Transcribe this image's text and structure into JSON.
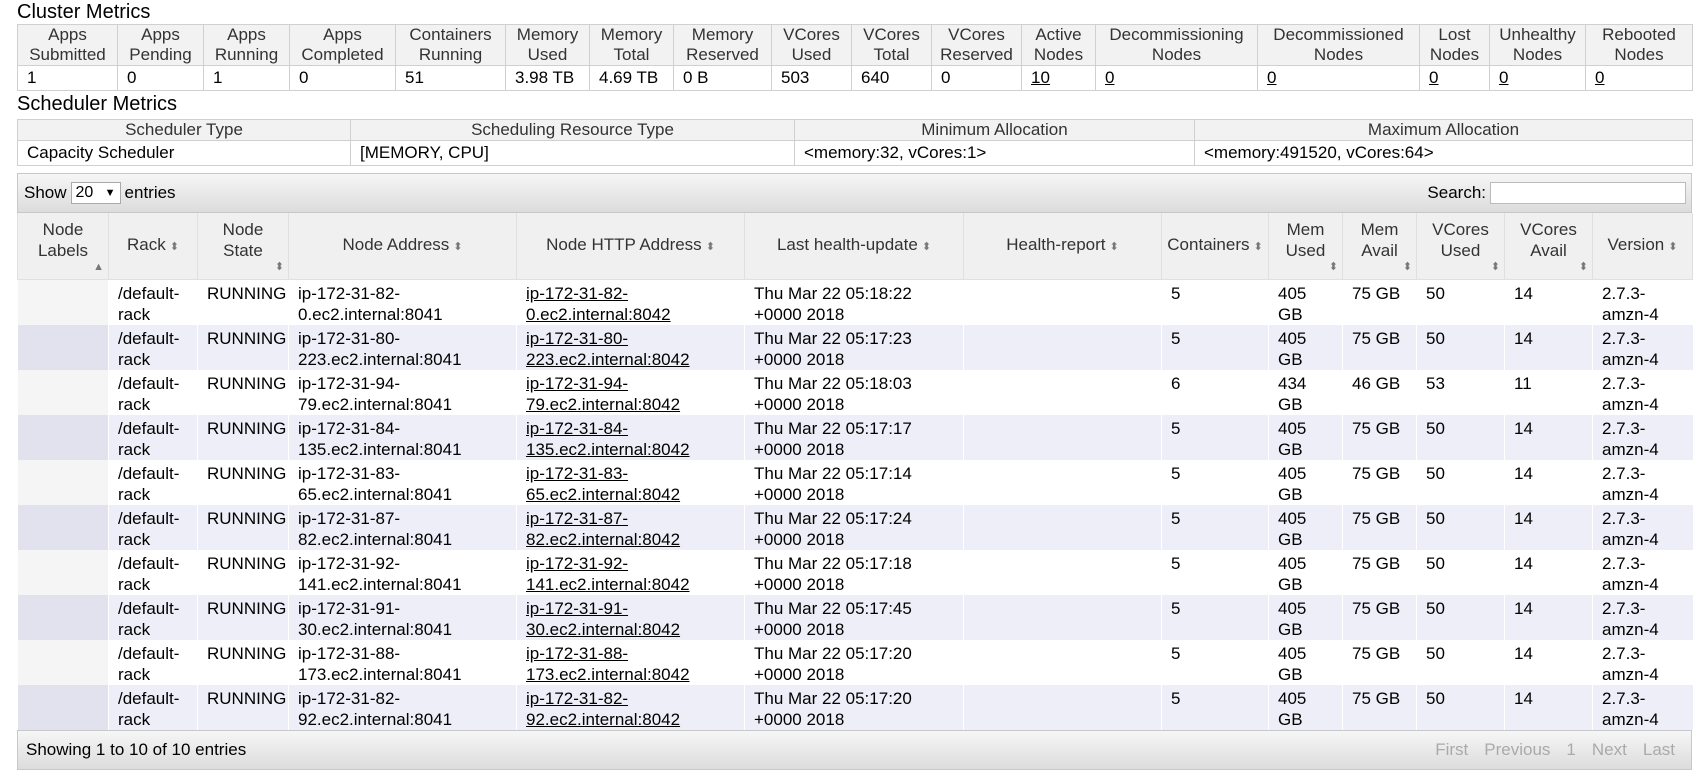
{
  "cluster_metrics": {
    "title": "Cluster Metrics",
    "headers": [
      [
        "Apps",
        "Submitted"
      ],
      [
        "Apps",
        "Pending"
      ],
      [
        "Apps",
        "Running"
      ],
      [
        "Apps",
        "Completed"
      ],
      [
        "Containers",
        "Running"
      ],
      [
        "Memory",
        "Used"
      ],
      [
        "Memory",
        "Total"
      ],
      [
        "Memory",
        "Reserved"
      ],
      [
        "VCores",
        "Used"
      ],
      [
        "VCores",
        "Total"
      ],
      [
        "VCores",
        "Reserved"
      ],
      [
        "Active",
        "Nodes"
      ],
      [
        "Decommissioning",
        "Nodes"
      ],
      [
        "Decommissioned",
        "Nodes"
      ],
      [
        "Lost",
        "Nodes"
      ],
      [
        "Unhealthy",
        "Nodes"
      ],
      [
        "Rebooted",
        "Nodes"
      ]
    ],
    "values": [
      "1",
      "0",
      "1",
      "0",
      "51",
      "3.98 TB",
      "4.69 TB",
      "0 B",
      "503",
      "640",
      "0",
      "10",
      "0",
      "0",
      "0",
      "0",
      "0"
    ]
  },
  "scheduler_metrics": {
    "title": "Scheduler Metrics",
    "headers": [
      "Scheduler Type",
      "Scheduling Resource Type",
      "Minimum Allocation",
      "Maximum Allocation"
    ],
    "values": [
      "Capacity Scheduler",
      "[MEMORY, CPU]",
      "<memory:32, vCores:1>",
      "<memory:491520, vCores:64>"
    ]
  },
  "toolbar": {
    "show_label": "Show",
    "entries_value": "20",
    "entries_label": "entries",
    "search_label": "Search:"
  },
  "nodes_table": {
    "headers": [
      [
        "Node",
        "Labels"
      ],
      [
        "Rack"
      ],
      [
        "Node",
        "State"
      ],
      [
        "Node Address"
      ],
      [
        "Node HTTP Address"
      ],
      [
        "Last health-update"
      ],
      [
        "Health-report"
      ],
      [
        "Containers"
      ],
      [
        "Mem",
        "Used"
      ],
      [
        "Mem",
        "Avail"
      ],
      [
        "VCores",
        "Used"
      ],
      [
        "VCores",
        "Avail"
      ],
      [
        "Version"
      ]
    ],
    "rows": [
      {
        "labels": "",
        "rack": [
          "/default-",
          "rack"
        ],
        "state": "RUNNING",
        "addr": [
          "ip-172-31-82-",
          "0.ec2.internal:8041"
        ],
        "http": [
          "ip-172-31-82-",
          "0.ec2.internal:8042"
        ],
        "update": [
          "Thu Mar 22 05:18:22",
          "+0000 2018"
        ],
        "health": "",
        "containers": "5",
        "mem_used": [
          "405",
          "GB"
        ],
        "mem_avail": "75 GB",
        "vc_used": "50",
        "vc_avail": "14",
        "version": [
          "2.7.3-",
          "amzn-4"
        ]
      },
      {
        "labels": "",
        "rack": [
          "/default-",
          "rack"
        ],
        "state": "RUNNING",
        "addr": [
          "ip-172-31-80-",
          "223.ec2.internal:8041"
        ],
        "http": [
          "ip-172-31-80-",
          "223.ec2.internal:8042"
        ],
        "update": [
          "Thu Mar 22 05:17:23",
          "+0000 2018"
        ],
        "health": "",
        "containers": "5",
        "mem_used": [
          "405",
          "GB"
        ],
        "mem_avail": "75 GB",
        "vc_used": "50",
        "vc_avail": "14",
        "version": [
          "2.7.3-",
          "amzn-4"
        ]
      },
      {
        "labels": "",
        "rack": [
          "/default-",
          "rack"
        ],
        "state": "RUNNING",
        "addr": [
          "ip-172-31-94-",
          "79.ec2.internal:8041"
        ],
        "http": [
          "ip-172-31-94-",
          "79.ec2.internal:8042"
        ],
        "update": [
          "Thu Mar 22 05:18:03",
          "+0000 2018"
        ],
        "health": "",
        "containers": "6",
        "mem_used": [
          "434",
          "GB"
        ],
        "mem_avail": "46 GB",
        "vc_used": "53",
        "vc_avail": "11",
        "version": [
          "2.7.3-",
          "amzn-4"
        ]
      },
      {
        "labels": "",
        "rack": [
          "/default-",
          "rack"
        ],
        "state": "RUNNING",
        "addr": [
          "ip-172-31-84-",
          "135.ec2.internal:8041"
        ],
        "http": [
          "ip-172-31-84-",
          "135.ec2.internal:8042"
        ],
        "update": [
          "Thu Mar 22 05:17:17",
          "+0000 2018"
        ],
        "health": "",
        "containers": "5",
        "mem_used": [
          "405",
          "GB"
        ],
        "mem_avail": "75 GB",
        "vc_used": "50",
        "vc_avail": "14",
        "version": [
          "2.7.3-",
          "amzn-4"
        ]
      },
      {
        "labels": "",
        "rack": [
          "/default-",
          "rack"
        ],
        "state": "RUNNING",
        "addr": [
          "ip-172-31-83-",
          "65.ec2.internal:8041"
        ],
        "http": [
          "ip-172-31-83-",
          "65.ec2.internal:8042"
        ],
        "update": [
          "Thu Mar 22 05:17:14",
          "+0000 2018"
        ],
        "health": "",
        "containers": "5",
        "mem_used": [
          "405",
          "GB"
        ],
        "mem_avail": "75 GB",
        "vc_used": "50",
        "vc_avail": "14",
        "version": [
          "2.7.3-",
          "amzn-4"
        ]
      },
      {
        "labels": "",
        "rack": [
          "/default-",
          "rack"
        ],
        "state": "RUNNING",
        "addr": [
          "ip-172-31-87-",
          "82.ec2.internal:8041"
        ],
        "http": [
          "ip-172-31-87-",
          "82.ec2.internal:8042"
        ],
        "update": [
          "Thu Mar 22 05:17:24",
          "+0000 2018"
        ],
        "health": "",
        "containers": "5",
        "mem_used": [
          "405",
          "GB"
        ],
        "mem_avail": "75 GB",
        "vc_used": "50",
        "vc_avail": "14",
        "version": [
          "2.7.3-",
          "amzn-4"
        ]
      },
      {
        "labels": "",
        "rack": [
          "/default-",
          "rack"
        ],
        "state": "RUNNING",
        "addr": [
          "ip-172-31-92-",
          "141.ec2.internal:8041"
        ],
        "http": [
          "ip-172-31-92-",
          "141.ec2.internal:8042"
        ],
        "update": [
          "Thu Mar 22 05:17:18",
          "+0000 2018"
        ],
        "health": "",
        "containers": "5",
        "mem_used": [
          "405",
          "GB"
        ],
        "mem_avail": "75 GB",
        "vc_used": "50",
        "vc_avail": "14",
        "version": [
          "2.7.3-",
          "amzn-4"
        ]
      },
      {
        "labels": "",
        "rack": [
          "/default-",
          "rack"
        ],
        "state": "RUNNING",
        "addr": [
          "ip-172-31-91-",
          "30.ec2.internal:8041"
        ],
        "http": [
          "ip-172-31-91-",
          "30.ec2.internal:8042"
        ],
        "update": [
          "Thu Mar 22 05:17:45",
          "+0000 2018"
        ],
        "health": "",
        "containers": "5",
        "mem_used": [
          "405",
          "GB"
        ],
        "mem_avail": "75 GB",
        "vc_used": "50",
        "vc_avail": "14",
        "version": [
          "2.7.3-",
          "amzn-4"
        ]
      },
      {
        "labels": "",
        "rack": [
          "/default-",
          "rack"
        ],
        "state": "RUNNING",
        "addr": [
          "ip-172-31-88-",
          "173.ec2.internal:8041"
        ],
        "http": [
          "ip-172-31-88-",
          "173.ec2.internal:8042"
        ],
        "update": [
          "Thu Mar 22 05:17:20",
          "+0000 2018"
        ],
        "health": "",
        "containers": "5",
        "mem_used": [
          "405",
          "GB"
        ],
        "mem_avail": "75 GB",
        "vc_used": "50",
        "vc_avail": "14",
        "version": [
          "2.7.3-",
          "amzn-4"
        ]
      },
      {
        "labels": "",
        "rack": [
          "/default-",
          "rack"
        ],
        "state": "RUNNING",
        "addr": [
          "ip-172-31-82-",
          "92.ec2.internal:8041"
        ],
        "http": [
          "ip-172-31-82-",
          "92.ec2.internal:8042"
        ],
        "update": [
          "Thu Mar 22 05:17:20",
          "+0000 2018"
        ],
        "health": "",
        "containers": "5",
        "mem_used": [
          "405",
          "GB"
        ],
        "mem_avail": "75 GB",
        "vc_used": "50",
        "vc_avail": "14",
        "version": [
          "2.7.3-",
          "amzn-4"
        ]
      }
    ]
  },
  "footer": {
    "info": "Showing 1 to 10 of 10 entries",
    "pager": [
      "First",
      "Previous",
      "1",
      "Next",
      "Last"
    ]
  }
}
